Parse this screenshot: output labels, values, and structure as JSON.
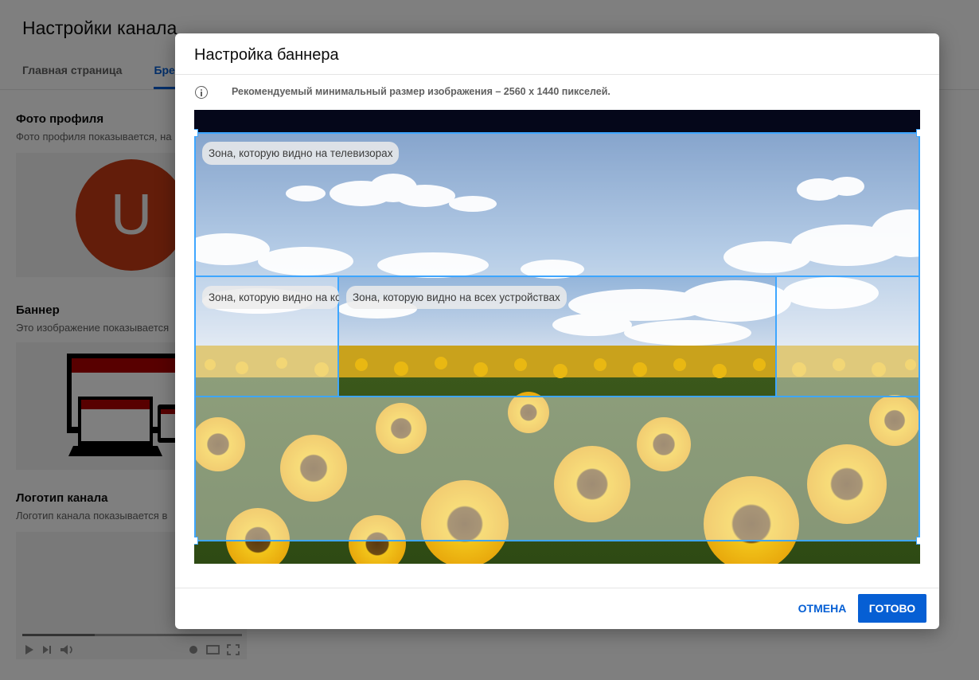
{
  "page": {
    "title": "Настройки канала",
    "tabs": [
      {
        "label": "Главная страница"
      },
      {
        "label": "Бренд"
      }
    ],
    "profile_photo": {
      "title": "Фото профиля",
      "description": "Фото профиля показывается, на",
      "avatar_letter": "U"
    },
    "banner": {
      "title": "Баннер",
      "description": "Это изображение показывается"
    },
    "channel_logo": {
      "title": "Логотип канала",
      "description": "Логотип канала показывается в"
    }
  },
  "dialog": {
    "title": "Настройка баннера",
    "info_text": "Рекомендуемый минимальный размер изображения – 2560 x 1440 пикселей.",
    "zones": {
      "tv": "Зона, которую видно на телевизорах",
      "desktop": "Зона, которую видно на компьютерах",
      "all_devices": "Зона, которую видно на всех устройствах"
    },
    "cancel_label": "ОТМЕНА",
    "done_label": "ГОТОВО"
  },
  "colors": {
    "accent": "#065fd4",
    "crop_outline": "#3ea6ff",
    "avatar": "#c63b14"
  },
  "icons": [
    "info-icon",
    "play-icon",
    "next-icon",
    "volume-icon",
    "settings-icon",
    "theater-icon",
    "fullscreen-icon"
  ]
}
